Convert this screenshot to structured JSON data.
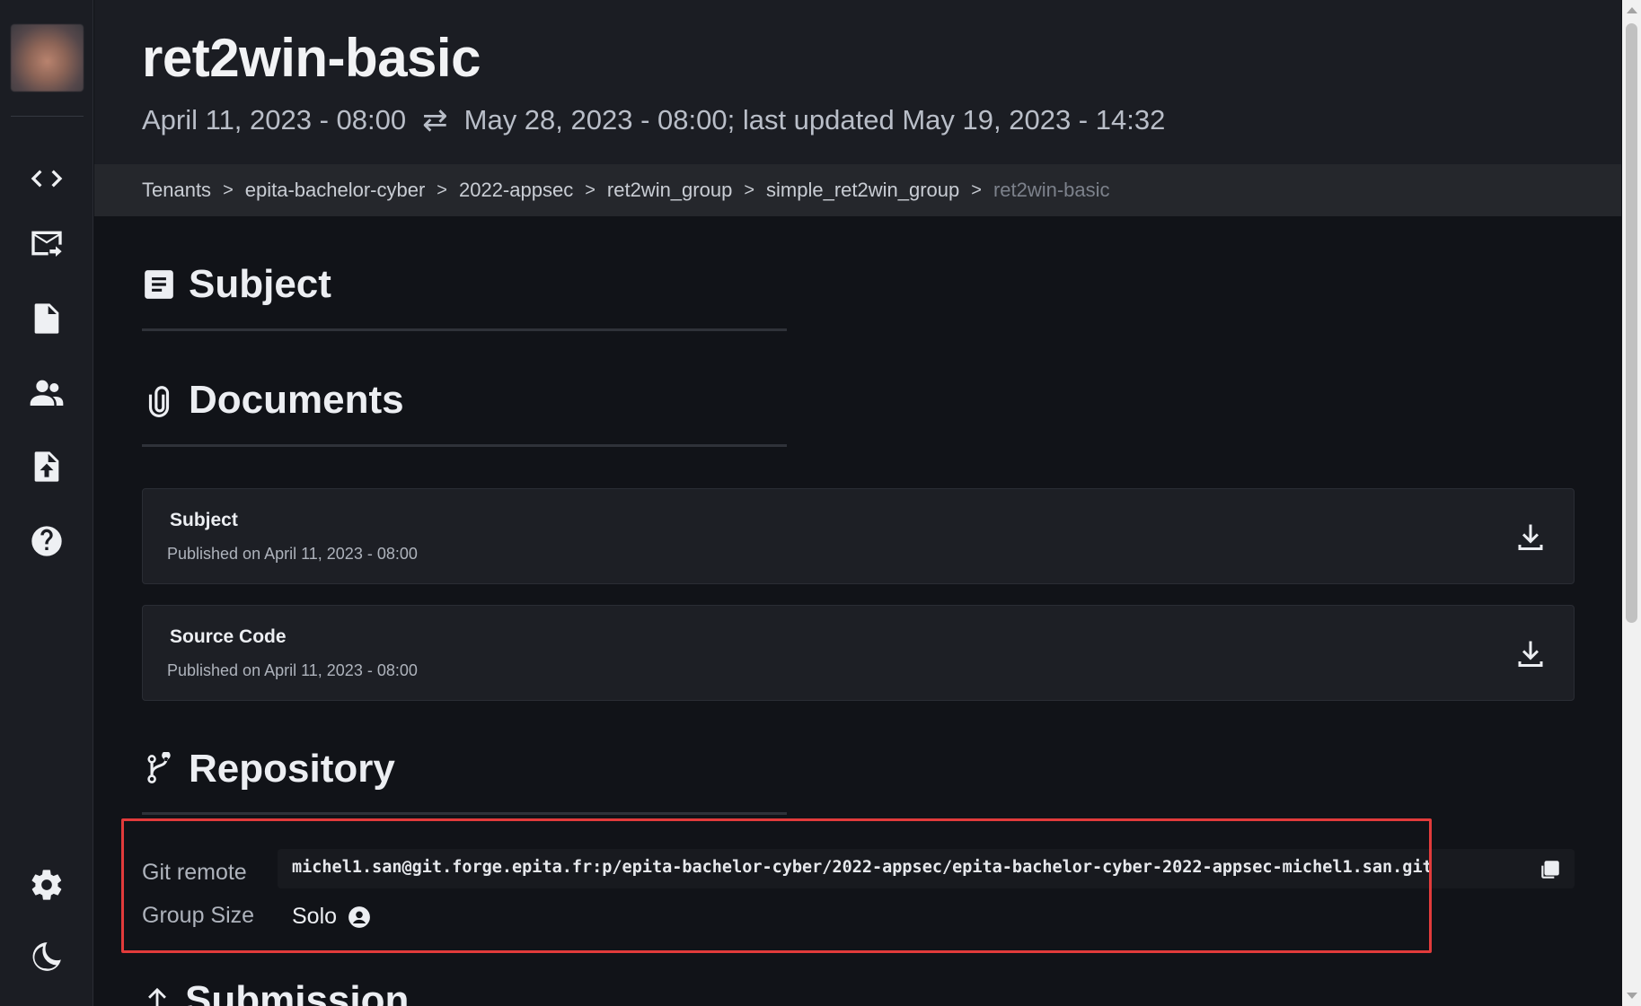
{
  "header": {
    "title": "ret2win-basic",
    "start_date": "April 11, 2023 - 08:00",
    "swap_symbol": "⇄",
    "end_info": "May 28, 2023 - 08:00; last updated May 19, 2023 - 14:32"
  },
  "breadcrumb": {
    "items": [
      "Tenants",
      "epita-bachelor-cyber",
      "2022-appsec",
      "ret2win_group",
      "simple_ret2win_group"
    ],
    "current": "ret2win-basic",
    "separator": ">"
  },
  "sections": {
    "subject": "Subject",
    "documents": "Documents",
    "repository": "Repository",
    "submission": "Submission"
  },
  "documents": [
    {
      "name": "Subject",
      "published": "Published on April 11, 2023 - 08:00"
    },
    {
      "name": "Source Code",
      "published": "Published on April 11, 2023 - 08:00"
    }
  ],
  "repository": {
    "git_remote_label": "Git remote",
    "git_remote_value": "michel1.san@git.forge.epita.fr:p/epita-bachelor-cyber/2022-appsec/epita-bachelor-cyber-2022-appsec-michel1.san.git",
    "group_size_label": "Group Size",
    "group_size_value": "Solo"
  },
  "sidebar": {
    "icons": [
      "code-icon",
      "mail-forward-icon",
      "file-icon",
      "users-icon",
      "file-upload-icon",
      "help-icon",
      "settings-icon",
      "moon-icon"
    ]
  },
  "colors": {
    "background": "#111318",
    "panel": "#1b1d23",
    "highlight": "#e23b3b"
  }
}
